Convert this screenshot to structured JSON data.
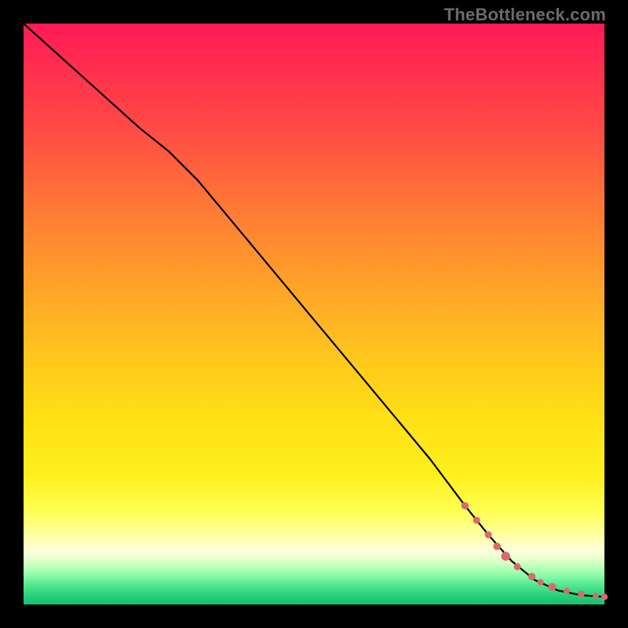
{
  "watermark": "TheBottleneck.com",
  "colors": {
    "marker": "#d86b6b",
    "curve": "#000000",
    "frame": "#000000"
  },
  "chart_data": {
    "type": "line",
    "title": "",
    "xlabel": "",
    "ylabel": "",
    "xlim": [
      0,
      100
    ],
    "ylim": [
      0,
      100
    ],
    "grid": false,
    "legend": false,
    "series": [
      {
        "name": "curve",
        "x": [
          0,
          10,
          20,
          25,
          30,
          40,
          50,
          60,
          70,
          76,
          80,
          84,
          88,
          92,
          96,
          100
        ],
        "y": [
          100,
          91,
          82,
          78,
          73,
          61,
          49,
          37,
          25,
          17,
          12,
          7.5,
          4.2,
          2.4,
          1.6,
          1.3
        ]
      }
    ],
    "markers": {
      "name": "highlight-points",
      "x": [
        76,
        78,
        80,
        81.5,
        83,
        85,
        87.5,
        89,
        91,
        93.5,
        96,
        98.5,
        100
      ],
      "y": [
        17,
        14.5,
        12,
        10,
        8.3,
        6.5,
        4.8,
        3.8,
        3.0,
        2.3,
        1.8,
        1.5,
        1.3
      ],
      "r": [
        4.2,
        4.0,
        4.0,
        4.2,
        5.2,
        4.0,
        4.2,
        3.6,
        4.6,
        3.6,
        3.8,
        3.4,
        3.6
      ]
    }
  }
}
